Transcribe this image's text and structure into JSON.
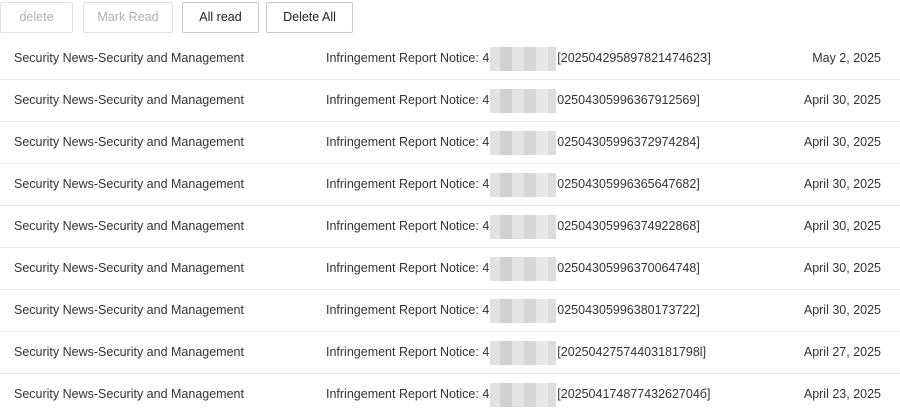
{
  "toolbar": {
    "delete_label": "delete",
    "mark_read_label": "Mark Read",
    "all_read_label": "All read",
    "delete_all_label": "Delete All"
  },
  "messages": [
    {
      "source": "Security News-Security and Management",
      "title_prefix": "Infringement Report Notice: 4",
      "title_suffix": "[20250429589782147462З]",
      "date": "May 2, 2025"
    },
    {
      "source": "Security News-Security and Management",
      "title_prefix": "Infringement Report Notice: 4",
      "title_suffix": "02504305996367912569]",
      "date": "April 30, 2025"
    },
    {
      "source": "Security News-Security and Management",
      "title_prefix": "Infringement Report Notice: 4",
      "title_suffix": "02504305996372974284]",
      "date": "April 30, 2025"
    },
    {
      "source": "Security News-Security and Management",
      "title_prefix": "Infringement Report Notice: 4",
      "title_suffix": "02504305996365647682]",
      "date": "April 30, 2025"
    },
    {
      "source": "Security News-Security and Management",
      "title_prefix": "Infringement Report Notice: 4",
      "title_suffix": "02504305996374922868]",
      "date": "April 30, 2025"
    },
    {
      "source": "Security News-Security and Management",
      "title_prefix": "Infringement Report Notice: 4",
      "title_suffix": "02504305996370064748]",
      "date": "April 30, 2025"
    },
    {
      "source": "Security News-Security and Management",
      "title_prefix": "Infringement Report Notice: 4",
      "title_suffix": "02504305996380173722]",
      "date": "April 30, 2025"
    },
    {
      "source": "Security News-Security and Management",
      "title_prefix": "Infringement Report Notice: 4",
      "title_suffix": "[20250427574403181798l]",
      "date": "April 27, 2025"
    },
    {
      "source": "Security News-Security and Management",
      "title_prefix": "Infringement Report Notice: 4",
      "title_suffix": "[20250417487743262704б]",
      "date": "April 23, 2025"
    }
  ]
}
